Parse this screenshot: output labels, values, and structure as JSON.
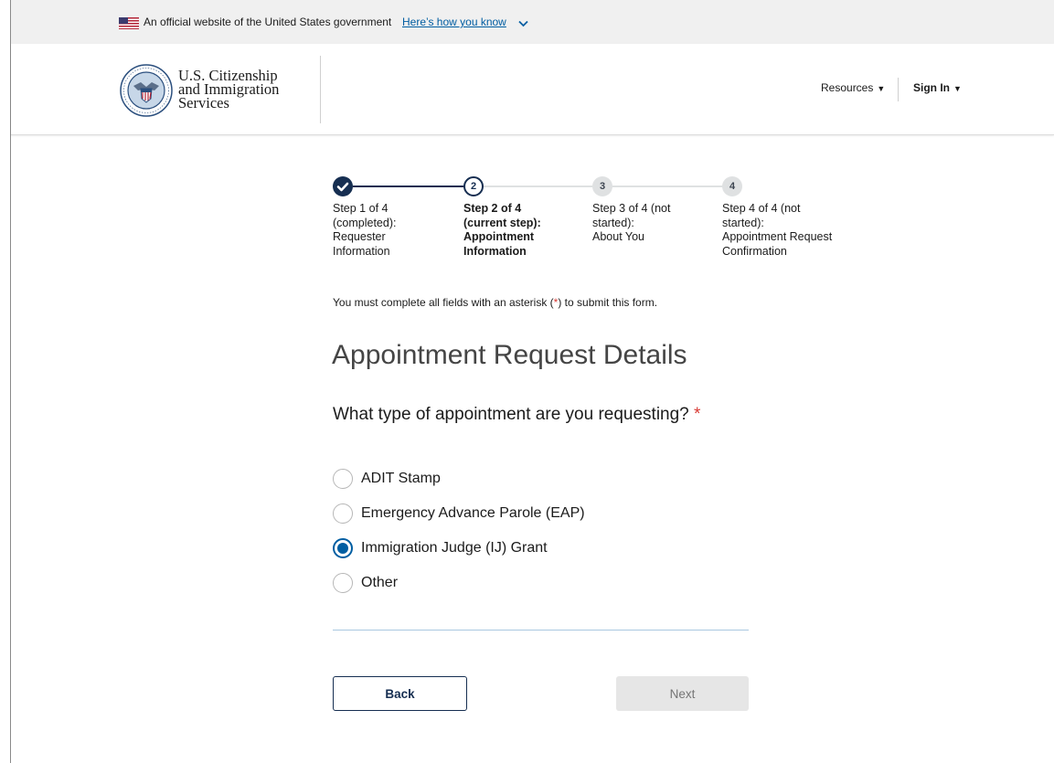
{
  "gov_banner": {
    "text": "An official website of the United States government",
    "link_text": "Here’s how you know"
  },
  "header": {
    "agency_line1": "U.S. Citizenship",
    "agency_line2": "and Immigration",
    "agency_line3": "Services",
    "resources_label": "Resources",
    "signin_label": "Sign In"
  },
  "steps": [
    {
      "number": "1",
      "state": "completed",
      "label": "Step 1 of 4\n(completed):\nRequester\nInformation"
    },
    {
      "number": "2",
      "state": "current",
      "label": "Step 2 of 4\n(current step):\nAppointment\nInformation"
    },
    {
      "number": "3",
      "state": "not-started",
      "label": "Step 3 of 4 (not\nstarted):\nAbout You"
    },
    {
      "number": "4",
      "state": "not-started",
      "label": "Step 4 of 4 (not\nstarted):\nAppointment Request\nConfirmation"
    }
  ],
  "form": {
    "required_note_before": "You must complete all fields with an asterisk (",
    "required_note_asterisk": "*",
    "required_note_after": ") to submit this form.",
    "title": "Appointment Request Details",
    "question": "What type of appointment are you requesting?",
    "question_required_mark": "*",
    "options": [
      {
        "label": "ADIT Stamp",
        "selected": false
      },
      {
        "label": "Emergency Advance Parole (EAP)",
        "selected": false
      },
      {
        "label": "Immigration Judge (IJ) Grant",
        "selected": true
      },
      {
        "label": "Other",
        "selected": false
      }
    ],
    "back_label": "Back",
    "next_label": "Next"
  },
  "colors": {
    "primary_dark": "#162e51",
    "link_blue": "#005ea2",
    "required_red": "#d83933",
    "disabled_gray": "#e6e6e6"
  }
}
